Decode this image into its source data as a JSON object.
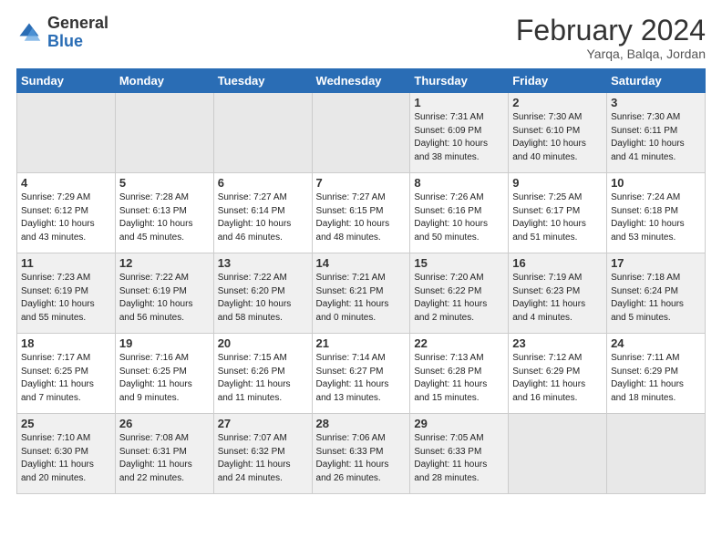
{
  "header": {
    "logo_general": "General",
    "logo_blue": "Blue",
    "month_title": "February 2024",
    "location": "Yarqa, Balqa, Jordan"
  },
  "weekdays": [
    "Sunday",
    "Monday",
    "Tuesday",
    "Wednesday",
    "Thursday",
    "Friday",
    "Saturday"
  ],
  "weeks": [
    [
      {
        "day": "",
        "info": ""
      },
      {
        "day": "",
        "info": ""
      },
      {
        "day": "",
        "info": ""
      },
      {
        "day": "",
        "info": ""
      },
      {
        "day": "1",
        "info": "Sunrise: 7:31 AM\nSunset: 6:09 PM\nDaylight: 10 hours\nand 38 minutes."
      },
      {
        "day": "2",
        "info": "Sunrise: 7:30 AM\nSunset: 6:10 PM\nDaylight: 10 hours\nand 40 minutes."
      },
      {
        "day": "3",
        "info": "Sunrise: 7:30 AM\nSunset: 6:11 PM\nDaylight: 10 hours\nand 41 minutes."
      }
    ],
    [
      {
        "day": "4",
        "info": "Sunrise: 7:29 AM\nSunset: 6:12 PM\nDaylight: 10 hours\nand 43 minutes."
      },
      {
        "day": "5",
        "info": "Sunrise: 7:28 AM\nSunset: 6:13 PM\nDaylight: 10 hours\nand 45 minutes."
      },
      {
        "day": "6",
        "info": "Sunrise: 7:27 AM\nSunset: 6:14 PM\nDaylight: 10 hours\nand 46 minutes."
      },
      {
        "day": "7",
        "info": "Sunrise: 7:27 AM\nSunset: 6:15 PM\nDaylight: 10 hours\nand 48 minutes."
      },
      {
        "day": "8",
        "info": "Sunrise: 7:26 AM\nSunset: 6:16 PM\nDaylight: 10 hours\nand 50 minutes."
      },
      {
        "day": "9",
        "info": "Sunrise: 7:25 AM\nSunset: 6:17 PM\nDaylight: 10 hours\nand 51 minutes."
      },
      {
        "day": "10",
        "info": "Sunrise: 7:24 AM\nSunset: 6:18 PM\nDaylight: 10 hours\nand 53 minutes."
      }
    ],
    [
      {
        "day": "11",
        "info": "Sunrise: 7:23 AM\nSunset: 6:19 PM\nDaylight: 10 hours\nand 55 minutes."
      },
      {
        "day": "12",
        "info": "Sunrise: 7:22 AM\nSunset: 6:19 PM\nDaylight: 10 hours\nand 56 minutes."
      },
      {
        "day": "13",
        "info": "Sunrise: 7:22 AM\nSunset: 6:20 PM\nDaylight: 10 hours\nand 58 minutes."
      },
      {
        "day": "14",
        "info": "Sunrise: 7:21 AM\nSunset: 6:21 PM\nDaylight: 11 hours\nand 0 minutes."
      },
      {
        "day": "15",
        "info": "Sunrise: 7:20 AM\nSunset: 6:22 PM\nDaylight: 11 hours\nand 2 minutes."
      },
      {
        "day": "16",
        "info": "Sunrise: 7:19 AM\nSunset: 6:23 PM\nDaylight: 11 hours\nand 4 minutes."
      },
      {
        "day": "17",
        "info": "Sunrise: 7:18 AM\nSunset: 6:24 PM\nDaylight: 11 hours\nand 5 minutes."
      }
    ],
    [
      {
        "day": "18",
        "info": "Sunrise: 7:17 AM\nSunset: 6:25 PM\nDaylight: 11 hours\nand 7 minutes."
      },
      {
        "day": "19",
        "info": "Sunrise: 7:16 AM\nSunset: 6:25 PM\nDaylight: 11 hours\nand 9 minutes."
      },
      {
        "day": "20",
        "info": "Sunrise: 7:15 AM\nSunset: 6:26 PM\nDaylight: 11 hours\nand 11 minutes."
      },
      {
        "day": "21",
        "info": "Sunrise: 7:14 AM\nSunset: 6:27 PM\nDaylight: 11 hours\nand 13 minutes."
      },
      {
        "day": "22",
        "info": "Sunrise: 7:13 AM\nSunset: 6:28 PM\nDaylight: 11 hours\nand 15 minutes."
      },
      {
        "day": "23",
        "info": "Sunrise: 7:12 AM\nSunset: 6:29 PM\nDaylight: 11 hours\nand 16 minutes."
      },
      {
        "day": "24",
        "info": "Sunrise: 7:11 AM\nSunset: 6:29 PM\nDaylight: 11 hours\nand 18 minutes."
      }
    ],
    [
      {
        "day": "25",
        "info": "Sunrise: 7:10 AM\nSunset: 6:30 PM\nDaylight: 11 hours\nand 20 minutes."
      },
      {
        "day": "26",
        "info": "Sunrise: 7:08 AM\nSunset: 6:31 PM\nDaylight: 11 hours\nand 22 minutes."
      },
      {
        "day": "27",
        "info": "Sunrise: 7:07 AM\nSunset: 6:32 PM\nDaylight: 11 hours\nand 24 minutes."
      },
      {
        "day": "28",
        "info": "Sunrise: 7:06 AM\nSunset: 6:33 PM\nDaylight: 11 hours\nand 26 minutes."
      },
      {
        "day": "29",
        "info": "Sunrise: 7:05 AM\nSunset: 6:33 PM\nDaylight: 11 hours\nand 28 minutes."
      },
      {
        "day": "",
        "info": ""
      },
      {
        "day": "",
        "info": ""
      }
    ]
  ]
}
